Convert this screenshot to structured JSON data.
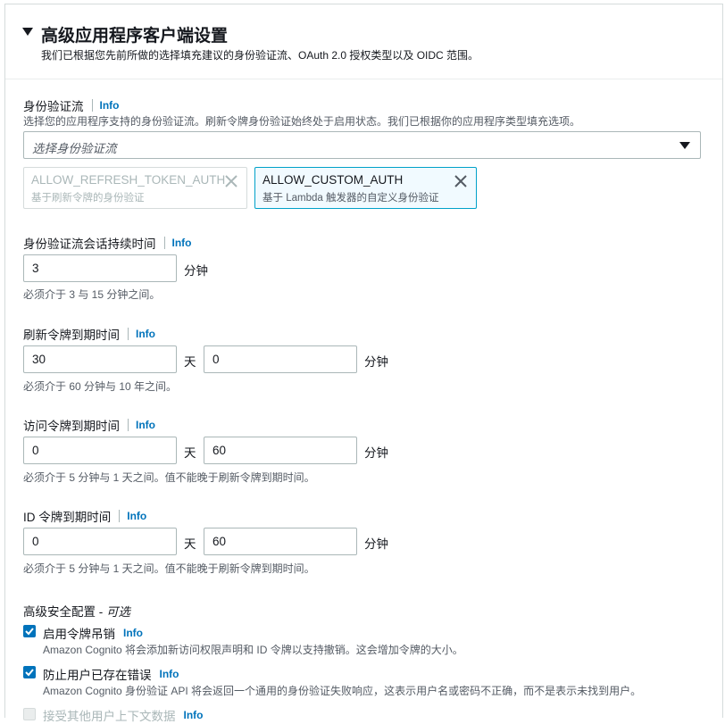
{
  "section": {
    "title": "高级应用程序客户端设置",
    "subtitle": "我们已根据您先前所做的选择填充建议的身份验证流、OAuth 2.0 授权类型以及 OIDC 范围。"
  },
  "info_label": "Info",
  "auth_flows": {
    "label": "身份验证流",
    "description": "选择您的应用程序支持的身份验证流。刷新令牌身份验证始终处于启用状态。我们已根据你的应用程序类型填充选项。",
    "placeholder": "选择身份验证流",
    "tokens": [
      {
        "name": "ALLOW_REFRESH_TOKEN_AUTH",
        "desc": "基于刷新令牌的身份验证",
        "disabled": true
      },
      {
        "name": "ALLOW_CUSTOM_AUTH",
        "desc": "基于 Lambda 触发器的自定义身份验证",
        "disabled": false
      }
    ]
  },
  "session_duration": {
    "label": "身份验证流会话持续时间",
    "value": "3",
    "unit": "分钟",
    "hint": "必须介于 3 与 15 分钟之间。"
  },
  "refresh_token": {
    "label": "刷新令牌到期时间",
    "days_value": "30",
    "days_unit": "天",
    "minutes_value": "0",
    "minutes_unit": "分钟",
    "hint": "必须介于 60 分钟与 10 年之间。"
  },
  "access_token": {
    "label": "访问令牌到期时间",
    "days_value": "0",
    "days_unit": "天",
    "minutes_value": "60",
    "minutes_unit": "分钟",
    "hint": "必须介于 5 分钟与 1 天之间。值不能晚于刷新令牌到期时间。"
  },
  "id_token": {
    "label": "ID 令牌到期时间",
    "days_value": "0",
    "days_unit": "天",
    "minutes_value": "60",
    "minutes_unit": "分钟",
    "hint": "必须介于 5 分钟与 1 天之间。值不能晚于刷新令牌到期时间。"
  },
  "advanced_security": {
    "label": "高级安全配置 - ",
    "optional": "可选",
    "options": [
      {
        "label": "启用令牌吊销",
        "desc": "Amazon Cognito 将会添加新访问权限声明和 ID 令牌以支持撤销。这会增加令牌的大小。",
        "checked": true
      },
      {
        "label": "防止用户已存在错误",
        "desc": "Amazon Cognito 身份验证 API 将会返回一个通用的身份验证失败响应，这表示用户名或密码不正确，而不是表示未找到用户。",
        "checked": true
      },
      {
        "label": "接受其他用户上下文数据",
        "checked": false
      }
    ]
  },
  "colors": {
    "link": "#0073bb",
    "checkbox": "#0073bb",
    "token_border": "#00a1c9",
    "token_bg": "#f1faff"
  }
}
